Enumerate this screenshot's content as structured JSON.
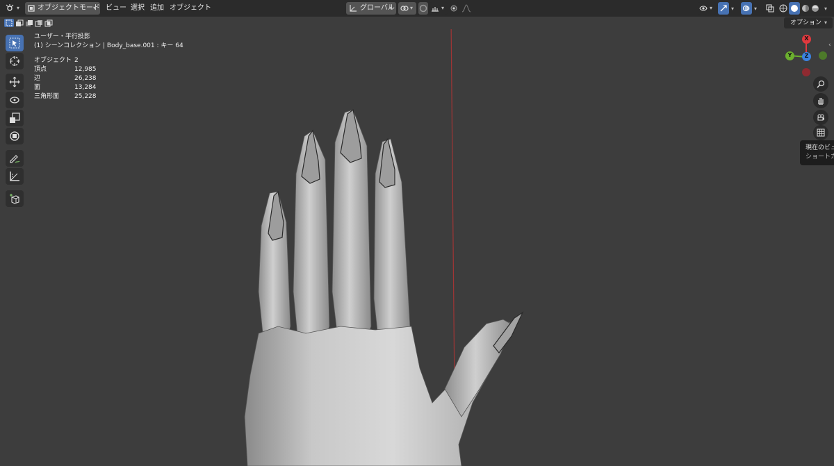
{
  "header": {
    "mode": "オブジェクトモード",
    "menus": [
      "ビュー",
      "選択",
      "追加",
      "オブジェクト"
    ],
    "transform_orientation": "グローバル"
  },
  "options_label": "オプション",
  "overlay_text": {
    "view_name": "ユーザー・平行投影",
    "collection": "(1) シーンコレクション | Body_base.001 : キー 64",
    "stats": [
      {
        "label": "オブジェクト",
        "value": "2"
      },
      {
        "label": "頂点",
        "value": "12,985"
      },
      {
        "label": "辺",
        "value": "26,238"
      },
      {
        "label": "面",
        "value": "13,284"
      },
      {
        "label": "三角形面",
        "value": "25,228"
      }
    ]
  },
  "gizmo": {
    "x": "X",
    "y": "Y",
    "z": "Z",
    "colors": {
      "x": "#e0393e",
      "y": "#6bb02e",
      "z": "#3b82e0"
    }
  },
  "tooltip": {
    "line1": "現在のビュ",
    "line2": "ショートカ"
  },
  "tools": [
    "tweak-tool",
    "cursor-tool",
    "move-tool",
    "rotate-tool",
    "scale-tool",
    "transform-tool",
    "annotate-tool",
    "measure-tool",
    "add-cube-tool"
  ],
  "colors": {
    "accent": "#4772b3",
    "viewport_bg": "#3d3d3d",
    "header_bg": "#2b2b2b",
    "axis_line": "#a13535"
  }
}
